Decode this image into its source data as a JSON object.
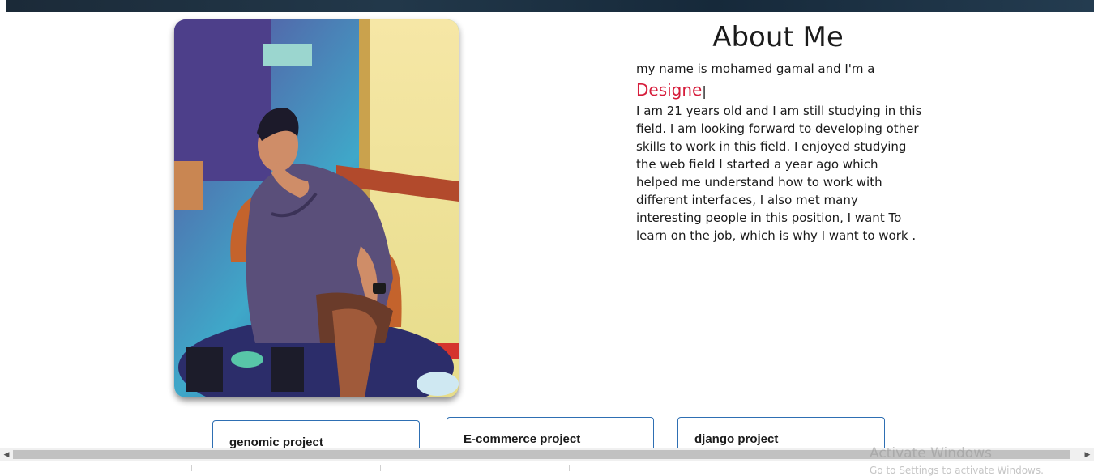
{
  "about": {
    "title": "About Me",
    "intro": "my name is mohamed gamal and I'm a",
    "role_typed": "Designe",
    "cursor": "|",
    "bio_lines": [
      "I am 21 years old and I am still studying in this",
      "field. I am looking forward to developing other",
      "skills to work in this field. I enjoyed studying",
      "the web field I started a year ago which",
      "helped me understand how to work with",
      "different interfaces, I also met many",
      "interesting people in this position, I want To",
      "learn on the job, which is why I want to work ."
    ]
  },
  "projects": [
    {
      "title": "genomic project"
    },
    {
      "title": "E-commerce project"
    },
    {
      "title": "django project"
    }
  ],
  "watermark": {
    "title": "Activate Windows",
    "subtitle": "Go to Settings to activate Windows."
  },
  "icons": {
    "scroll_left": "triangle-left",
    "scroll_right": "triangle-right"
  },
  "colors": {
    "accent_role": "#d61d3b",
    "card_border": "#2e6fb3"
  }
}
